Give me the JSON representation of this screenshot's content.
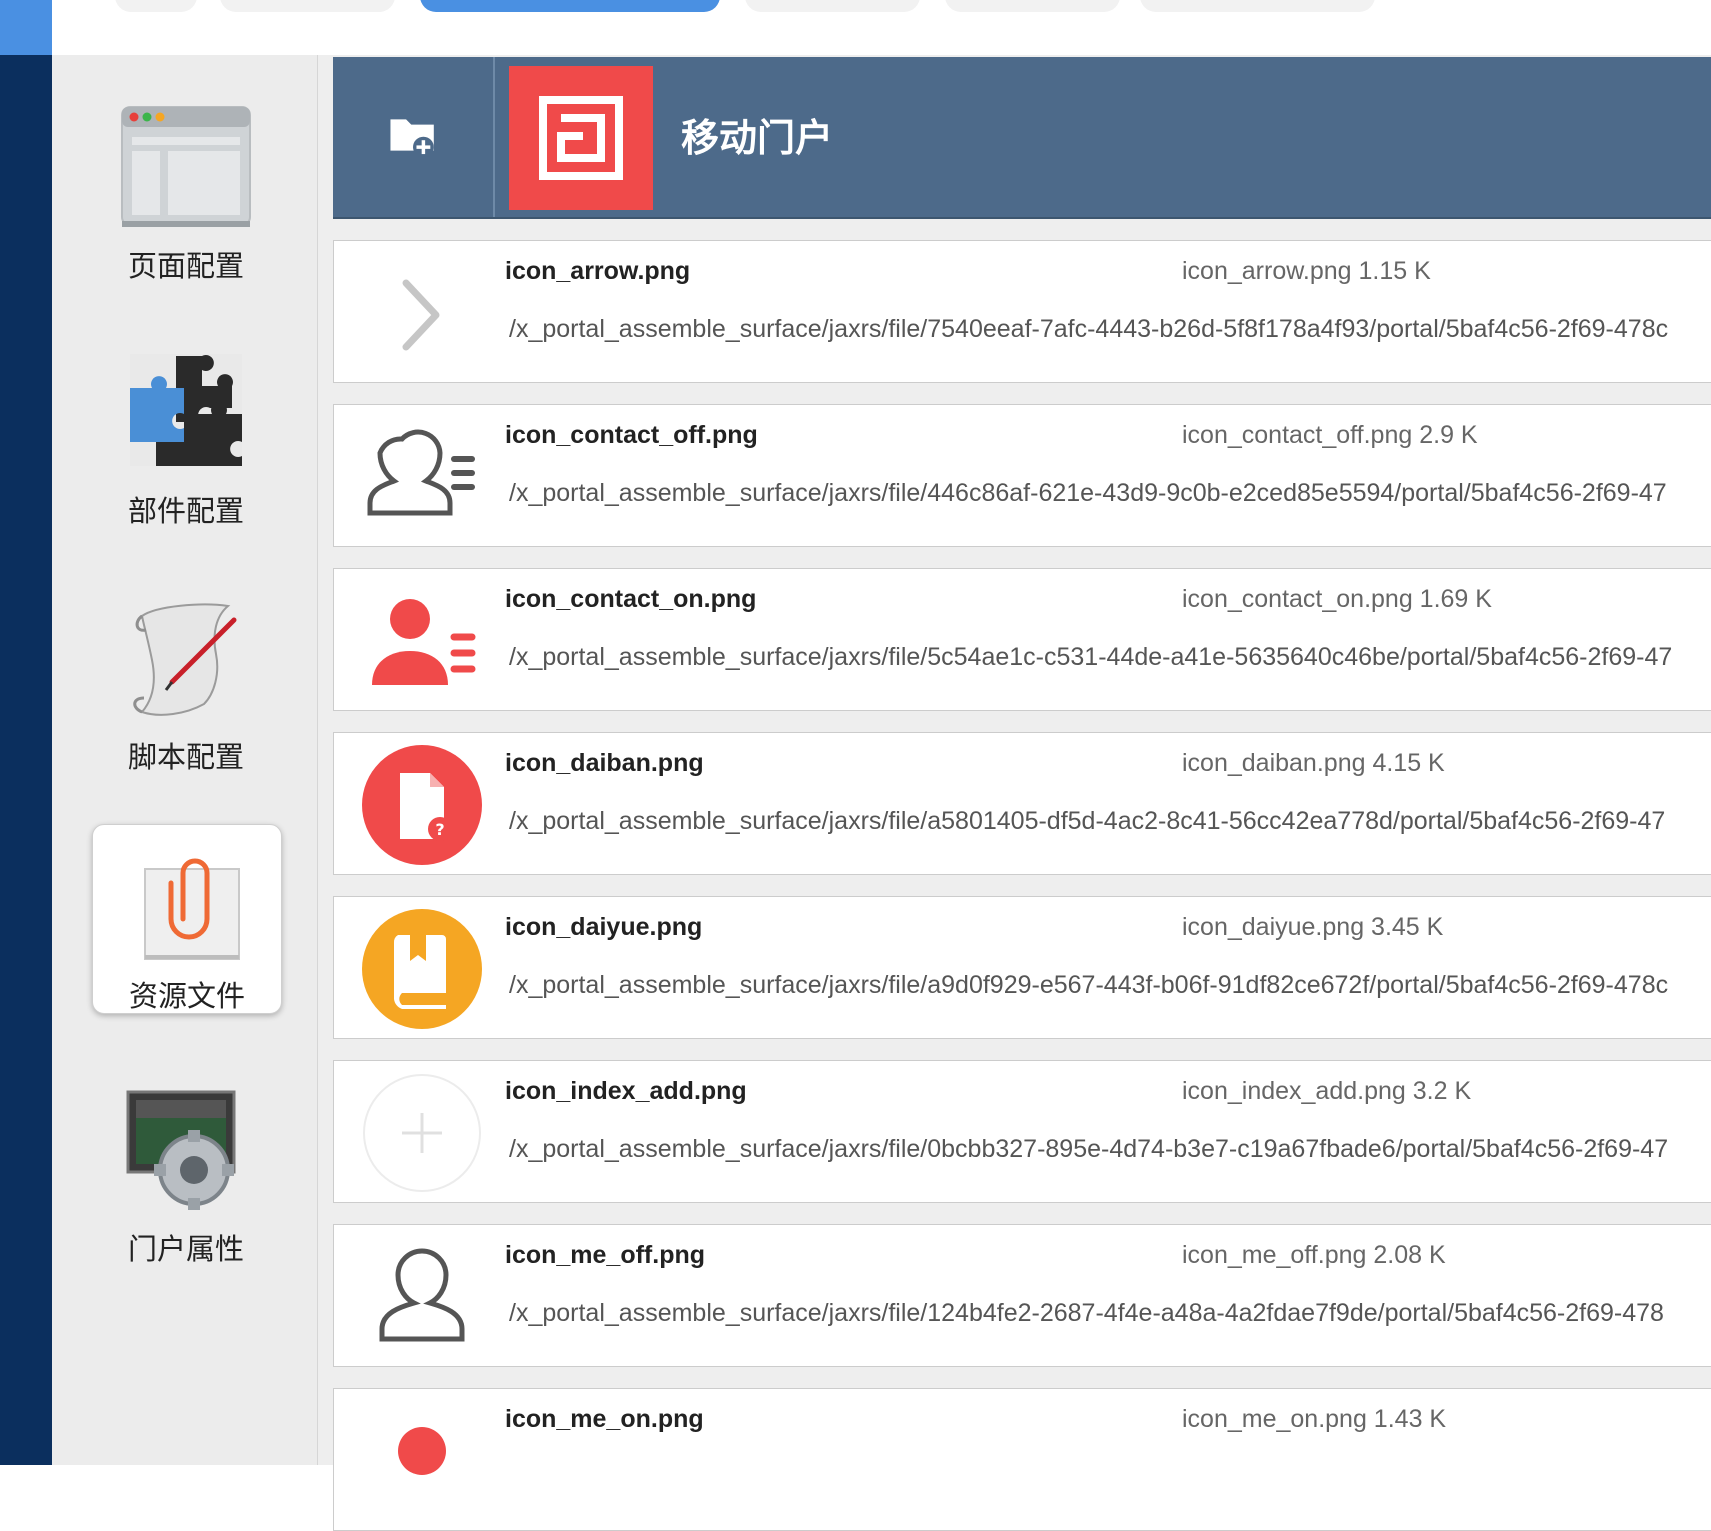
{
  "header": {
    "title": "移动门户"
  },
  "tools": [
    {
      "label": "页面配置",
      "icon": "page-layout-icon"
    },
    {
      "label": "部件配置",
      "icon": "puzzle-icon"
    },
    {
      "label": "脚本配置",
      "icon": "script-scroll-icon"
    },
    {
      "label": "资源文件",
      "icon": "paperclip-file-icon",
      "active": true
    },
    {
      "label": "门户属性",
      "icon": "gear-monitor-icon"
    }
  ],
  "files": [
    {
      "name": "icon_arrow.png",
      "info": "icon_arrow.png 1.15 K",
      "path": "/x_portal_assemble_surface/jaxrs/file/7540eeaf-7afc-4443-b26d-5f8f178a4f93/portal/5baf4c56-2f69-478c",
      "icon": "chevron-right-icon"
    },
    {
      "name": "icon_contact_off.png",
      "info": "icon_contact_off.png 2.9 K",
      "path": "/x_portal_assemble_surface/jaxrs/file/446c86af-621e-43d9-9c0b-e2ced85e5594/portal/5baf4c56-2f69-47",
      "icon": "contact-outline-icon"
    },
    {
      "name": "icon_contact_on.png",
      "info": "icon_contact_on.png 1.69 K",
      "path": "/x_portal_assemble_surface/jaxrs/file/5c54ae1c-c531-44de-a41e-5635640c46be/portal/5baf4c56-2f69-47",
      "icon": "contact-filled-icon"
    },
    {
      "name": "icon_daiban.png",
      "info": "icon_daiban.png 4.15 K",
      "path": "/x_portal_assemble_surface/jaxrs/file/a5801405-df5d-4ac2-8c41-56cc42ea778d/portal/5baf4c56-2f69-47",
      "icon": "todo-document-icon"
    },
    {
      "name": "icon_daiyue.png",
      "info": "icon_daiyue.png 3.45 K",
      "path": "/x_portal_assemble_surface/jaxrs/file/a9d0f929-e567-443f-b06f-91df82ce672f/portal/5baf4c56-2f69-478c",
      "icon": "book-icon"
    },
    {
      "name": "icon_index_add.png",
      "info": "icon_index_add.png 3.2 K",
      "path": "/x_portal_assemble_surface/jaxrs/file/0bcbb327-895e-4d74-b3e7-c19a67fbade6/portal/5baf4c56-2f69-47",
      "icon": "plus-circle-icon"
    },
    {
      "name": "icon_me_off.png",
      "info": "icon_me_off.png 2.08 K",
      "path": "/x_portal_assemble_surface/jaxrs/file/124b4fe2-2687-4f4e-a48a-4a2fdae7f9de/portal/5baf4c56-2f69-478",
      "icon": "person-outline-icon"
    },
    {
      "name": "icon_me_on.png",
      "info": "icon_me_on.png 1.43 K",
      "path": "",
      "icon": "person-filled-icon"
    }
  ],
  "colors": {
    "header": "#4d6a8a",
    "accent_red": "#f04a4a",
    "accent_orange": "#f5a623",
    "sidebar_dark": "#0b2f5e",
    "tab_active": "#4a90e2"
  }
}
